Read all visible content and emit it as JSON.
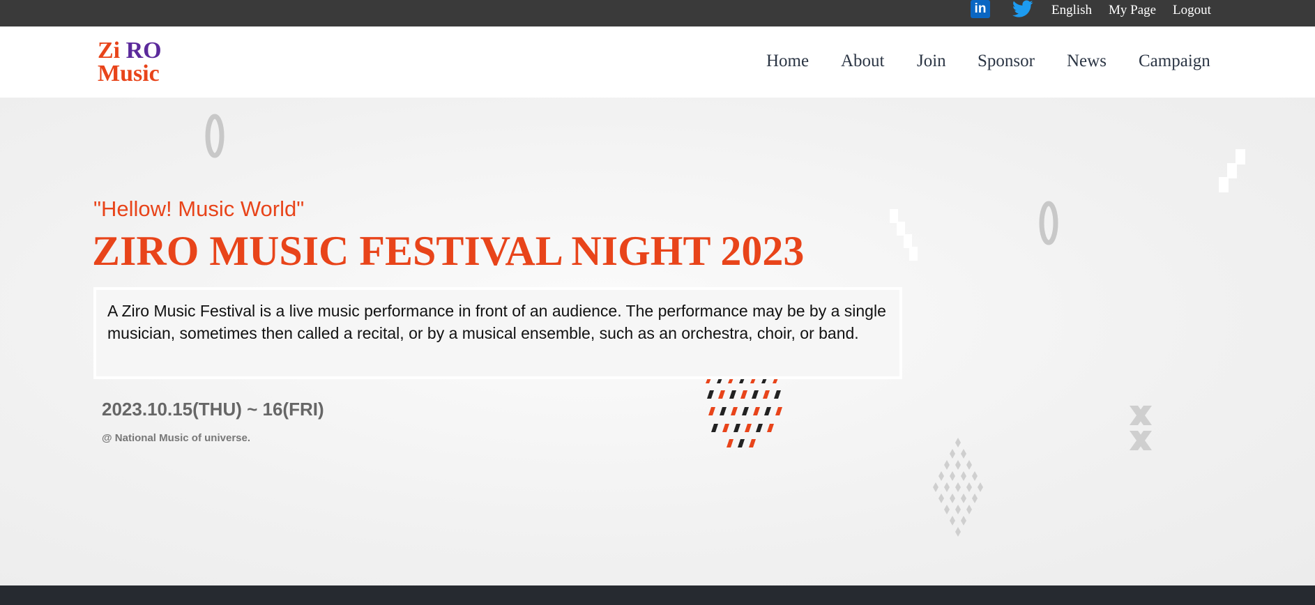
{
  "topbar": {
    "linkedin_icon": "linkedin-icon",
    "twitter_icon": "twitter-icon",
    "linkedin_glyph": "in",
    "language": "English",
    "my_page": "My Page",
    "logout": "Logout"
  },
  "header": {
    "logo": {
      "line1_a": "Zi",
      "line1_b": "RO",
      "line2": "Music"
    },
    "nav": [
      "Home",
      "About",
      "Join",
      "Sponsor",
      "News",
      "Campaign"
    ]
  },
  "hero": {
    "tagline": "\"Hellow! Music World\"",
    "title": "ZIRO MUSIC FESTIVAL NIGHT 2023",
    "description": "A Ziro Music Festival is a live music performance in front of an audience. The performance may be by a single musician, sometimes then called a recital, or by a musical ensemble, such as an orchestra, choir, or band.",
    "dates": "2023.10.15(THU) ~ 16(FRI)",
    "venue": "@ National Music of universe."
  },
  "colors": {
    "accent": "#e8441a",
    "logo_purple": "#5b2a9b",
    "topbar_bg": "#3a3a3a",
    "nav_text": "#2b3544",
    "footer_bg": "#262a30"
  }
}
